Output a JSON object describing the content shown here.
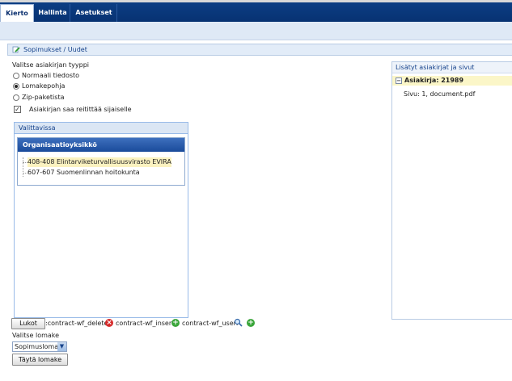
{
  "nav": {
    "tabs": [
      "Kierto",
      "Hallinta",
      "Asetukset"
    ],
    "active": "Kierto"
  },
  "breadcrumb": "Sopimukset / Uudet",
  "doc_type": {
    "label": "Valitse asiakirjan tyyppi",
    "options": [
      "Normaali tiedosto",
      "Lomakepohja",
      "Zip-paketista"
    ],
    "selected": "Lomakepohja"
  },
  "forward_checkbox": {
    "label": "Asiakirjan saa reitittää sijaiselle",
    "checked": true
  },
  "available_panel": {
    "title": "Valittavissa",
    "grid_header": "Organisaatioyksikkö",
    "items": [
      "408-408 Elintarviketurvallisuusvirasto EVIRA",
      "607-607 Suomenlinnan hoitokunta"
    ]
  },
  "added_panel": {
    "title": "Lisätyt asiakirjat ja sivut",
    "document": "Asiakirja: 21989",
    "page": "Sivu: 1, document.pdf"
  },
  "actions": {
    "lock_button": "Lukot",
    "delete_label": ":contract-wf_delete:",
    "insert_label": "contract-wf_insert:",
    "user_label": "contract-wf_user:"
  },
  "form": {
    "label": "Valitse lomake",
    "selected": "Sopimuslomake",
    "fill_button": "Täytä lomake"
  },
  "colors": {
    "nav": "#0c3f86",
    "header_grid": "#1a4b9a",
    "highlight": "#fbf2c0"
  }
}
